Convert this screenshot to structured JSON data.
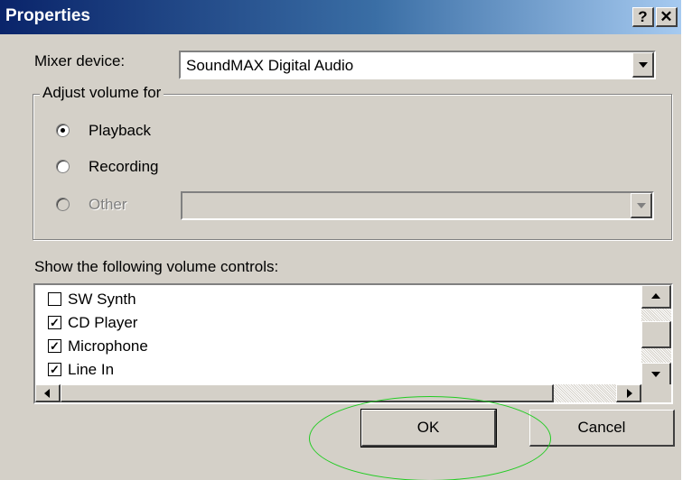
{
  "dialog": {
    "title": "Properties",
    "help_button": "?",
    "close_button": "✕"
  },
  "mixer": {
    "label": "Mixer device:",
    "value": "SoundMAX Digital Audio"
  },
  "adjust_group": {
    "legend": "Adjust volume for",
    "options": [
      {
        "label": "Playback",
        "selected": true,
        "enabled": true
      },
      {
        "label": "Recording",
        "selected": false,
        "enabled": true
      },
      {
        "label": "Other",
        "selected": false,
        "enabled": false
      }
    ],
    "other_value": ""
  },
  "controls": {
    "heading": "Show the following volume controls:",
    "items": [
      {
        "label": "SW Synth",
        "checked": false,
        "mark": ""
      },
      {
        "label": "CD Player",
        "checked": true,
        "mark": "✓"
      },
      {
        "label": "Microphone",
        "checked": true,
        "mark": "✓"
      },
      {
        "label": "Line In",
        "checked": true,
        "mark": "✓"
      }
    ]
  },
  "buttons": {
    "ok": "OK",
    "cancel": "Cancel"
  },
  "colors": {
    "title_bar_start": "#0a246a",
    "title_bar_end": "#a6caf0",
    "dialog_face": "#d4d0c8",
    "highlight_ellipse": "#22cc22"
  }
}
